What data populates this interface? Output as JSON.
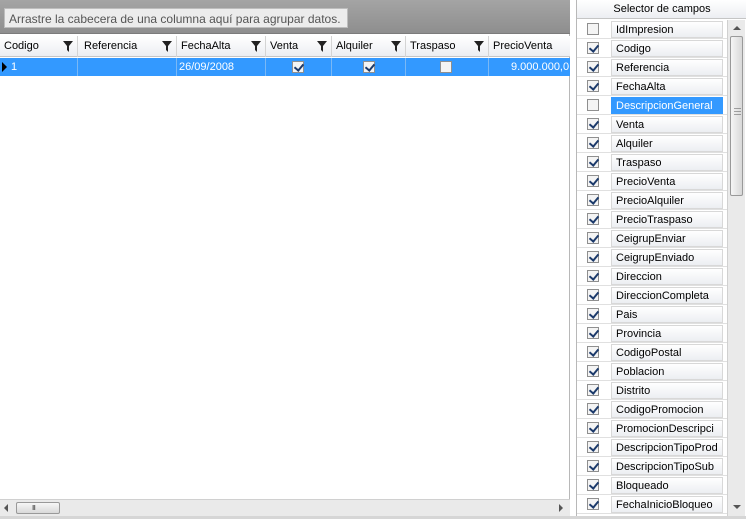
{
  "group_panel": {
    "hint": "Arrastre la cabecera de una columna aquí para agrupar datos."
  },
  "grid": {
    "columns": [
      {
        "label": "Codigo"
      },
      {
        "label": "Referencia"
      },
      {
        "label": "FechaAlta"
      },
      {
        "label": "Venta"
      },
      {
        "label": "Alquiler"
      },
      {
        "label": "Traspaso"
      },
      {
        "label": "PrecioVenta"
      }
    ],
    "row": {
      "codigo": "1",
      "referencia": "",
      "fecha_alta": "26/09/2008",
      "venta": true,
      "alquiler": true,
      "traspaso": false,
      "precio_venta": "9.000.000,0"
    },
    "selected_row_color": "#3399ff"
  },
  "scroll_grip": "III",
  "selector": {
    "title": "Selector de campos",
    "fields": [
      {
        "label": "IdImpresion",
        "checked": false
      },
      {
        "label": "Codigo",
        "checked": true
      },
      {
        "label": "Referencia",
        "checked": true
      },
      {
        "label": "FechaAlta",
        "checked": true
      },
      {
        "label": "DescripcionGeneral",
        "checked": false,
        "selected": true
      },
      {
        "label": "Venta",
        "checked": true
      },
      {
        "label": "Alquiler",
        "checked": true
      },
      {
        "label": "Traspaso",
        "checked": true
      },
      {
        "label": "PrecioVenta",
        "checked": true
      },
      {
        "label": "PrecioAlquiler",
        "checked": true
      },
      {
        "label": "PrecioTraspaso",
        "checked": true
      },
      {
        "label": "CeigrupEnviar",
        "checked": true
      },
      {
        "label": "CeigrupEnviado",
        "checked": true
      },
      {
        "label": "Direccion",
        "checked": true
      },
      {
        "label": "DireccionCompleta",
        "checked": true
      },
      {
        "label": "Pais",
        "checked": true
      },
      {
        "label": "Provincia",
        "checked": true
      },
      {
        "label": "CodigoPostal",
        "checked": true
      },
      {
        "label": "Poblacion",
        "checked": true
      },
      {
        "label": "Distrito",
        "checked": true
      },
      {
        "label": "CodigoPromocion",
        "checked": true
      },
      {
        "label": "PromocionDescripci",
        "checked": true
      },
      {
        "label": "DescripcionTipoProd",
        "checked": true
      },
      {
        "label": "DescripcionTipoSub",
        "checked": true
      },
      {
        "label": "Bloqueado",
        "checked": true
      },
      {
        "label": "FechaInicioBloqueo",
        "checked": true
      }
    ]
  }
}
